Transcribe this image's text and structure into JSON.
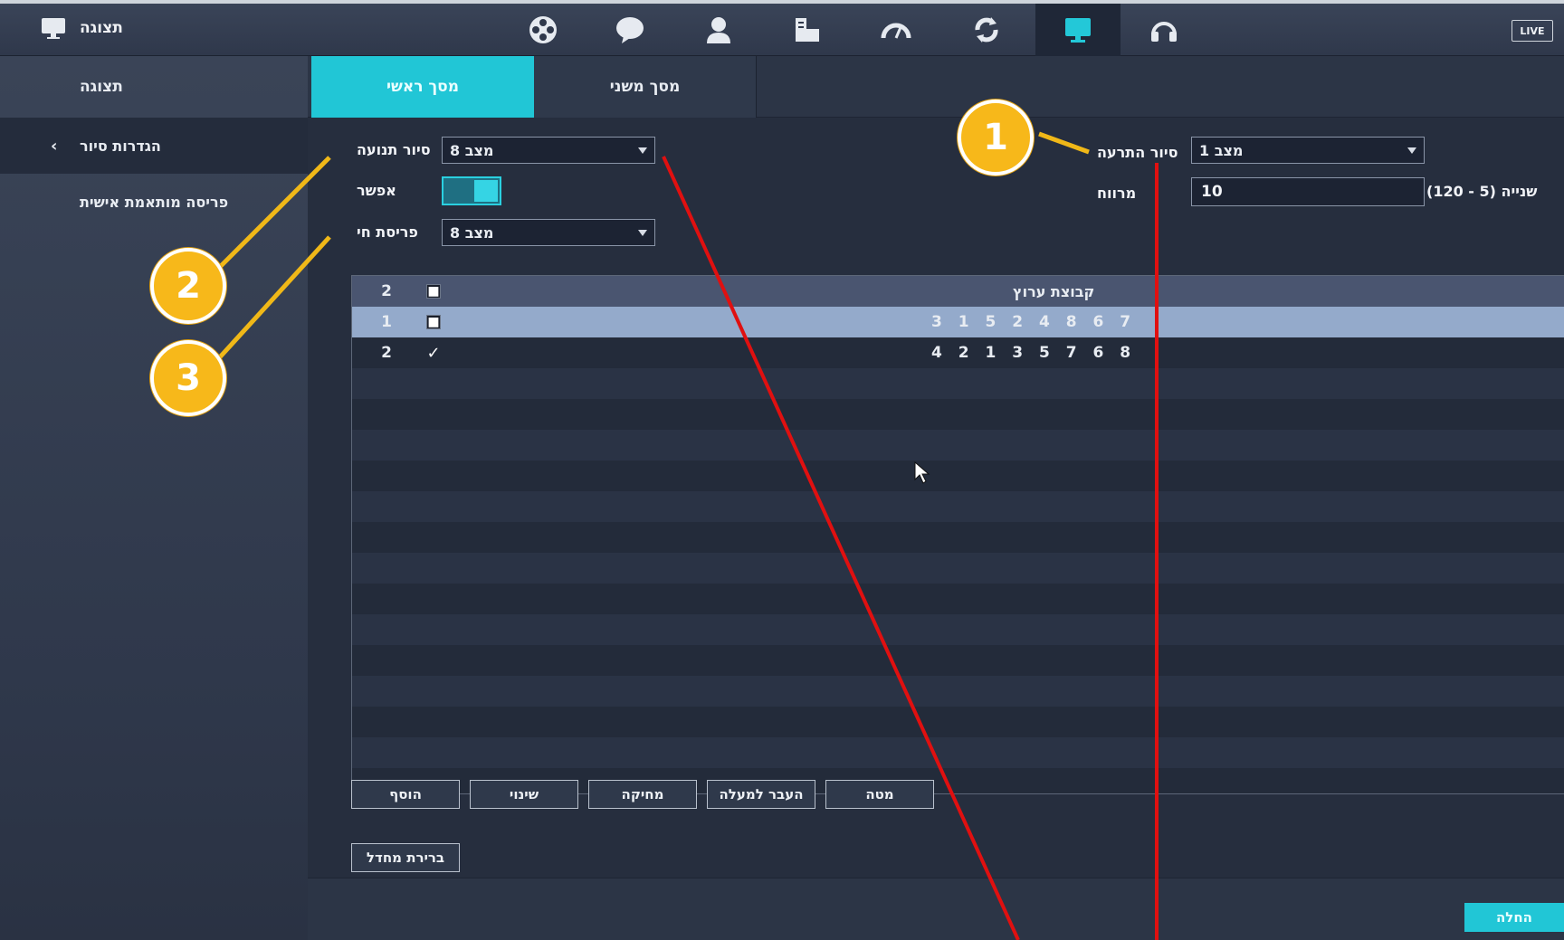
{
  "topbar": {
    "brand_label": "תצוגה",
    "live_badge": "LIVE",
    "nav_icons": [
      "film-reel-icon",
      "chat-bubble-icon",
      "person-icon",
      "device-list-icon",
      "gauge-icon",
      "refresh-icon",
      "monitor-icon",
      "headset-icon"
    ]
  },
  "sidebar": {
    "header": "תצוגה",
    "items": [
      {
        "label": "הגדרות סיור",
        "active": true
      },
      {
        "label": "פריסה מותאמת אישית",
        "active": false
      }
    ]
  },
  "tabs": [
    {
      "label": "מסך ראשי",
      "active": true
    },
    {
      "label": "מסך משני",
      "active": false
    }
  ],
  "form": {
    "motion_tour_label": "סיור תנועה",
    "motion_tour_value": "מצב 8",
    "enable_label": "אפשר",
    "live_layout_label": "פריסת חי",
    "live_layout_value": "מצב 8",
    "alarm_tour_label": "סיור התרעה",
    "alarm_tour_value": "מצב 1",
    "interval_label": "מרווח",
    "interval_value": "10",
    "interval_unit": "שנייה (5 - 120)"
  },
  "table": {
    "header": {
      "num": "2",
      "title": "קבוצת ערוץ"
    },
    "rows": [
      {
        "num": "1",
        "checked": false,
        "sequence": "3 1 5 2 4 8 6 7"
      },
      {
        "num": "2",
        "checked": true,
        "sequence": "4 2 1 3 5 7 6 8"
      }
    ]
  },
  "buttons": {
    "add": "הוסף",
    "modify": "שינוי",
    "delete": "מחיקה",
    "move_up": "העבר למעלה",
    "move_down": "מטה",
    "default": "ברירת מחדל",
    "apply": "החלה"
  },
  "callouts": [
    "1",
    "2",
    "3"
  ],
  "colors": {
    "accent": "#21c6d6",
    "callout": "#f7b81a",
    "annotation_line": "#e01010"
  }
}
